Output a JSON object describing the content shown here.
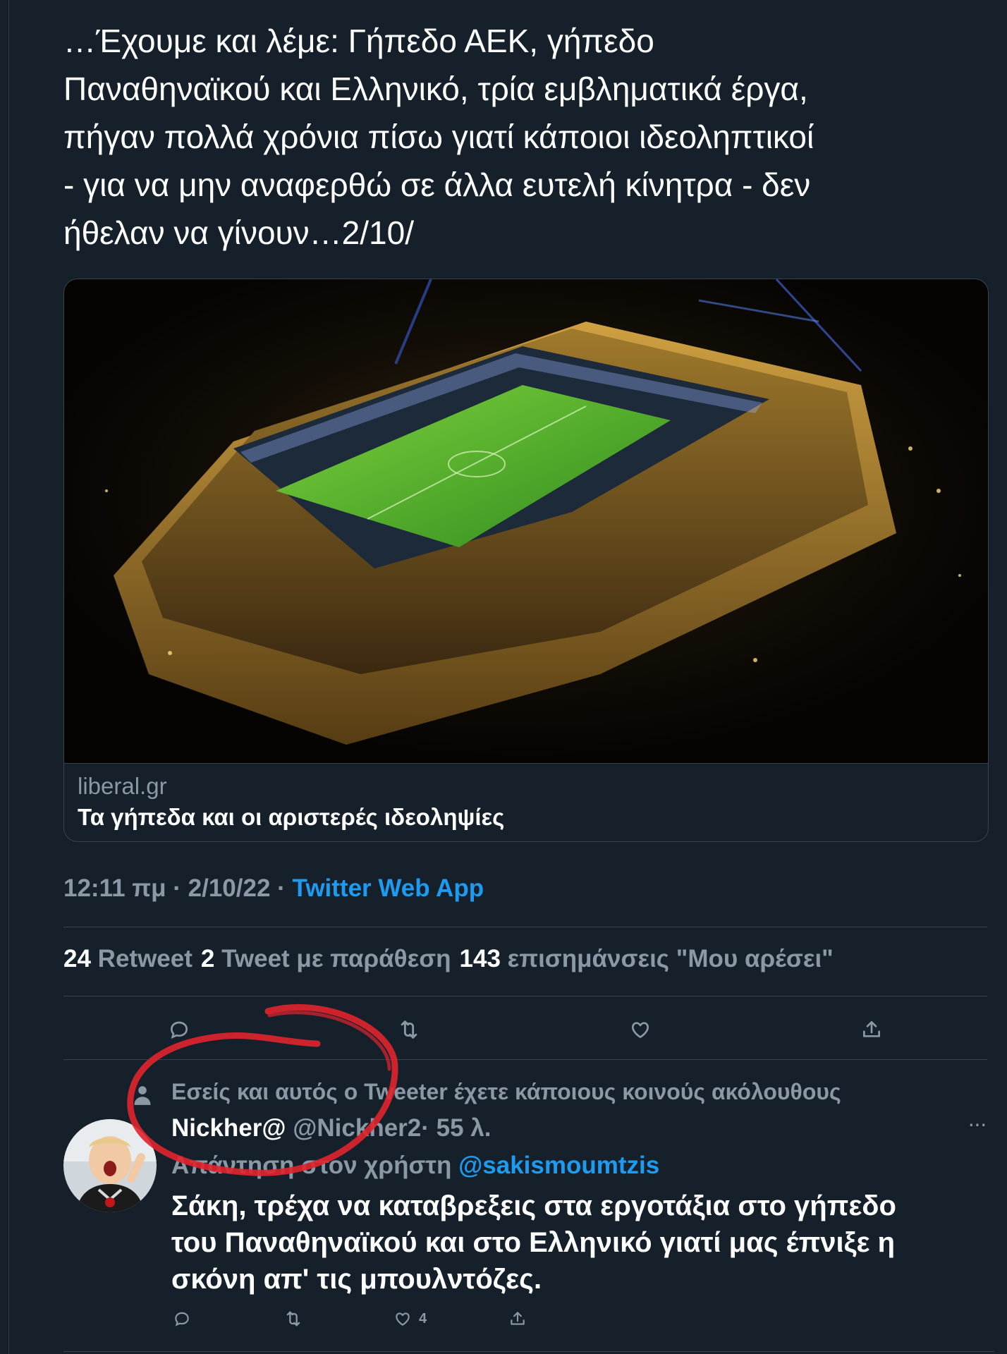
{
  "tweet": {
    "text": "…Έχουμε και λέμε: Γήπεδο ΑΕΚ, γήπεδο\nΠαναθηναϊκού και Ελληνικό, τρία εμβληματικά έργα,\nπήγαν πολλά χρόνια πίσω γιατί κάποιοι ιδεοληπτικοί\n- για να μην αναφερθώ σε άλλα ευτελή κίνητρα - δεν\nήθελαν να γίνουν…2/10/",
    "link_card": {
      "domain": "liberal.gr",
      "title": "Τα γήπεδα και οι αριστερές ιδεοληψίες",
      "image_icon": "stadium-night-aerial-photo"
    },
    "meta": {
      "time": "12:11 πμ",
      "separator": " · ",
      "date": "2/10/22",
      "separator2": " · ",
      "source": "Twitter Web App"
    },
    "stats": {
      "retweets_count": "24",
      "retweets_label": "Retweet",
      "quotes_count": "2",
      "quotes_label": "Tweet με παράθεση",
      "likes_count": "143",
      "likes_label": "επισημάνσεις \"Μου αρέσει\""
    },
    "actions": [
      "reply-icon",
      "retweet-icon",
      "like-icon",
      "share-icon"
    ]
  },
  "reply": {
    "social_context": "Εσείς και αυτός ο Tweeter έχετε κάποιους κοινούς ακόλουθους",
    "author_name": "Nickher@",
    "author_handle": "@Nickher2",
    "time": "· 55 λ.",
    "more": "···",
    "replying_to_label": "Απάντηση στον χρήστη",
    "replying_to_handle": "@sakismoumtzis",
    "text": "Σάκη, τρέχα να καταβρεξεις στα εργοτάξια στο γήπεδο\nτου Παναθηναϊκού και στο Ελληνικό γιατί μας έπνιξε η\nσκόνη απ' τις μπουλντόζες.",
    "like_count": "4"
  },
  "colors": {
    "background": "#15202b",
    "text": "#ffffff",
    "secondary": "#8b98a5",
    "accent": "#1d9bf0",
    "border": "#38444d",
    "annotation": "#e0242c"
  }
}
